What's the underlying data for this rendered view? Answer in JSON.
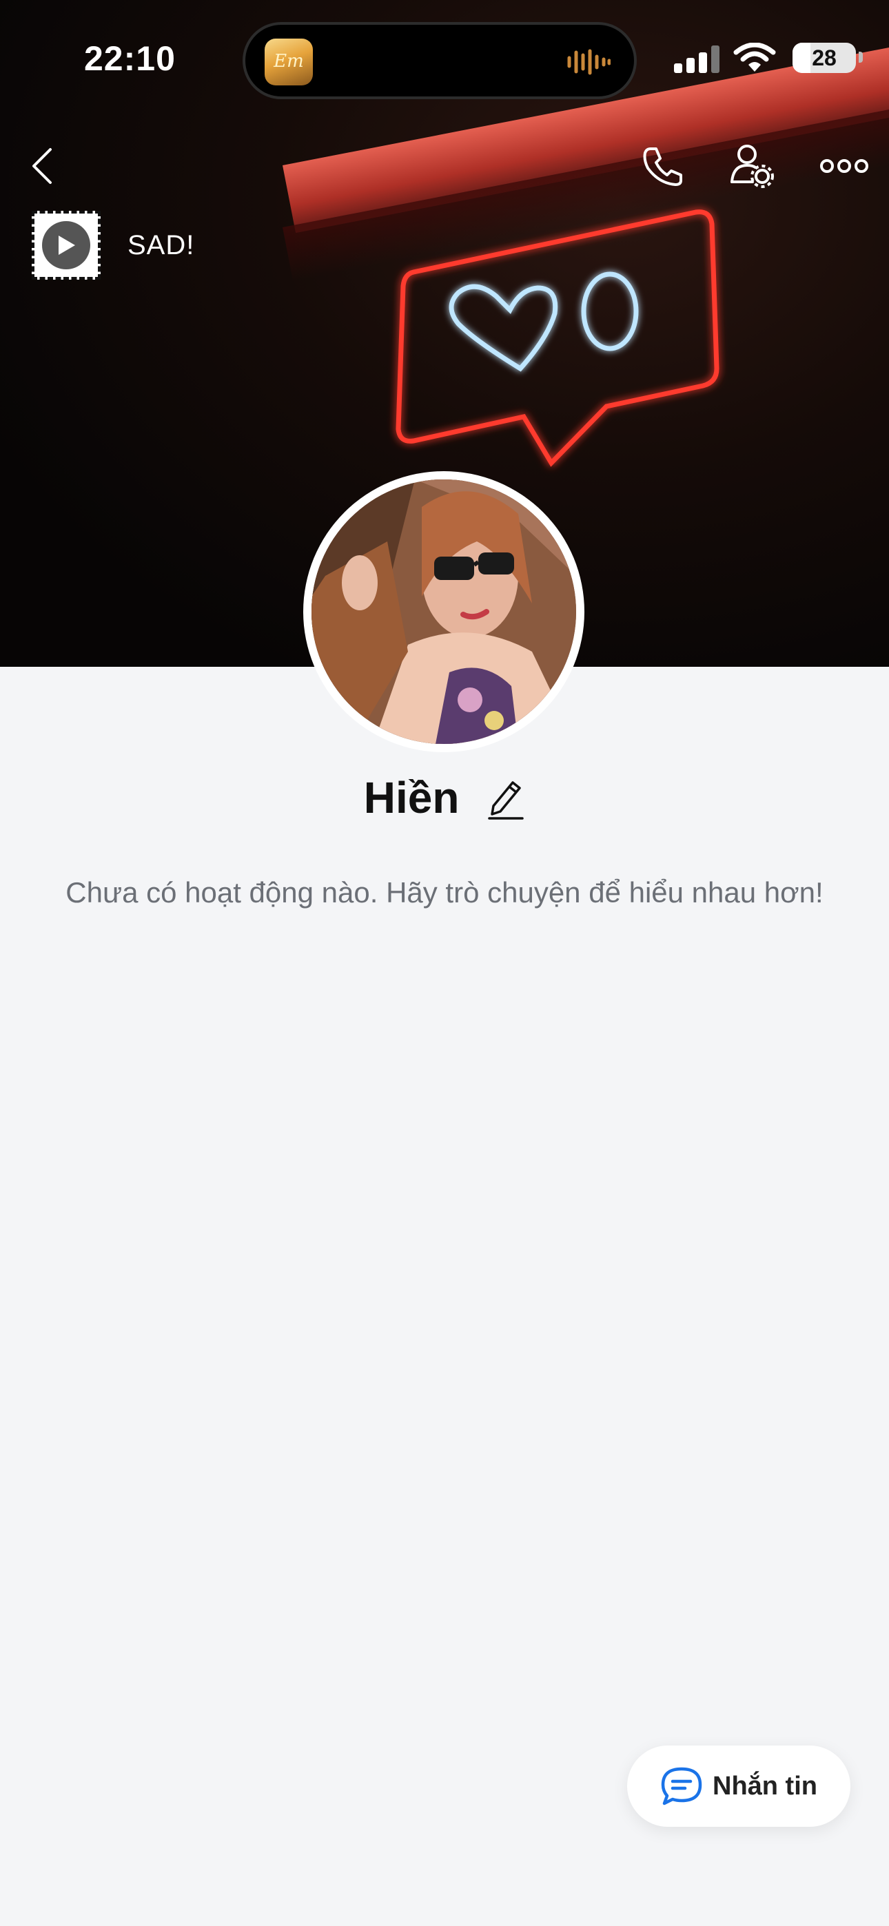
{
  "status_bar": {
    "time": "22:10",
    "battery_level": "28",
    "battery_fraction": 0.28,
    "island_app_label": "Em"
  },
  "header": {
    "back_icon": "chevron-left-icon",
    "call_icon": "phone-icon",
    "settings_icon": "user-settings-icon",
    "more_icon": "more-horizontal-icon"
  },
  "music": {
    "title": "SAD!",
    "play_icon": "play-icon"
  },
  "profile": {
    "name": "Hiền",
    "edit_icon": "pencil-icon"
  },
  "feed": {
    "empty_message": "Chưa có hoạt động nào. Hãy trò chuyện để hiểu nhau hơn!"
  },
  "fab": {
    "label": "Nhắn tin",
    "icon": "chat-bubble-icon",
    "icon_color": "#1a73e8"
  },
  "colors": {
    "background": "#f4f5f7",
    "neon_red": "#ff3b2f",
    "neon_blue": "#bfe6ff"
  }
}
